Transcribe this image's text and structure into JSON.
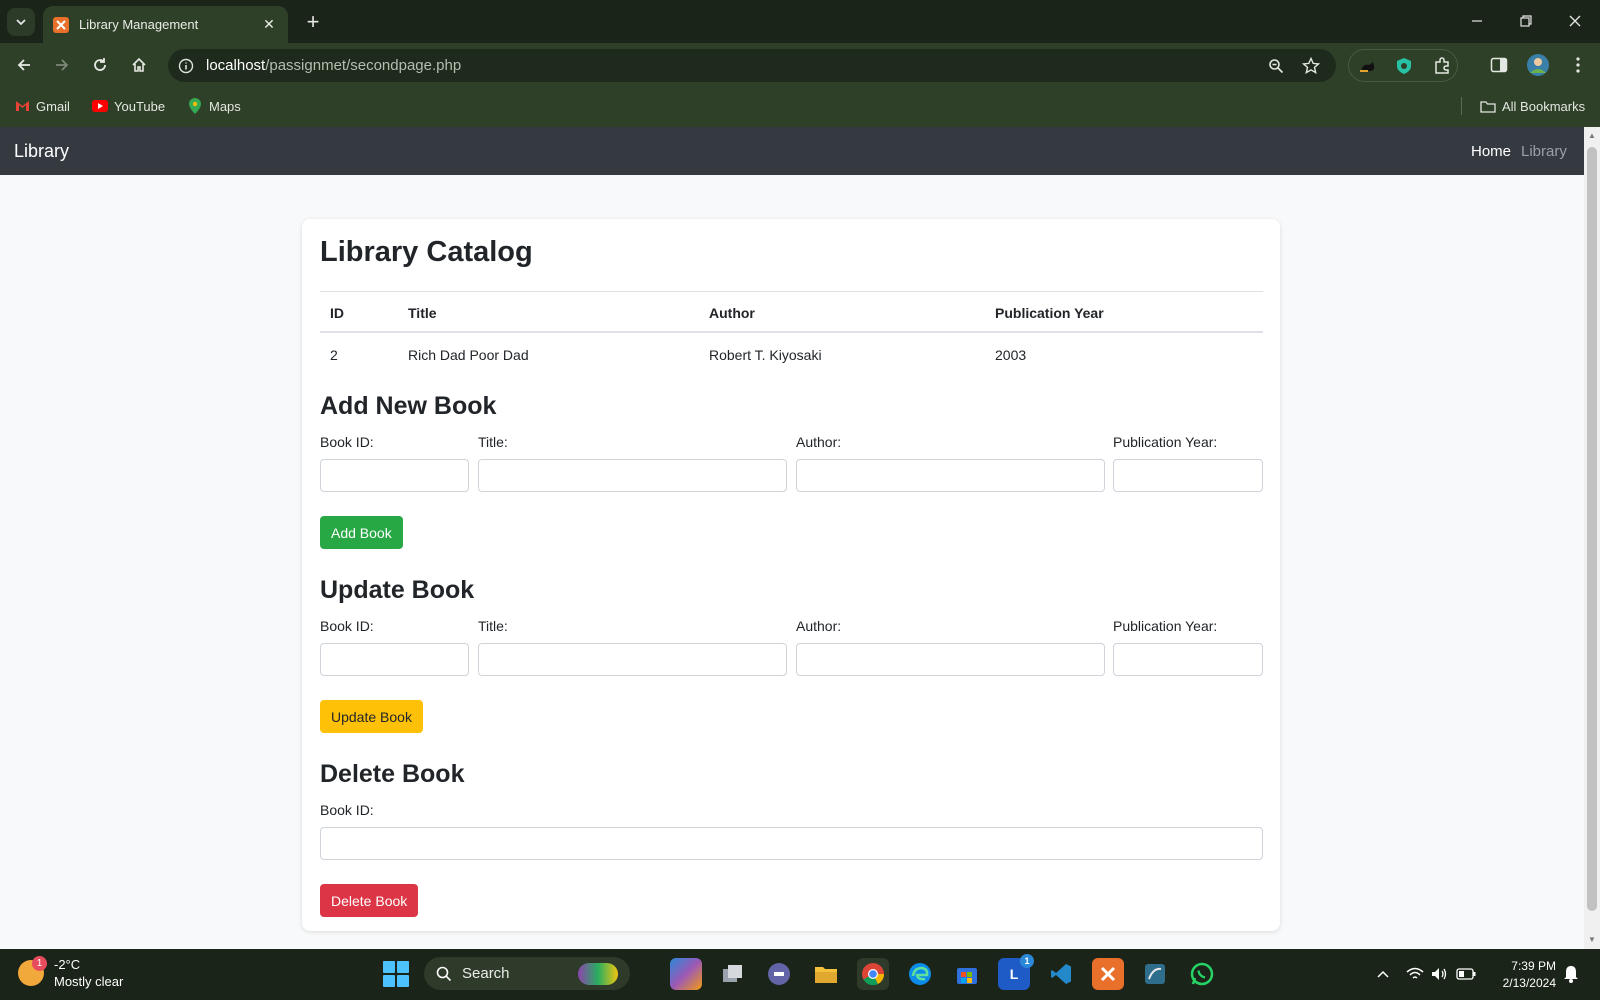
{
  "browser": {
    "tab_title": "Library Management",
    "tab_close": "✕",
    "new_tab": "+",
    "url_host": "localhost",
    "url_path": "/passignmet/secondpage.php",
    "bookmarks": [
      {
        "label": "Gmail",
        "icon": "gmail-icon",
        "color": "#ea4335"
      },
      {
        "label": "YouTube",
        "icon": "youtube-icon",
        "color": "#ff0000"
      },
      {
        "label": "Maps",
        "icon": "maps-icon",
        "color": "#34a853"
      }
    ],
    "all_bookmarks": "All Bookmarks"
  },
  "navbar": {
    "brand": "Library",
    "links": [
      {
        "label": "Home",
        "color": "#ffffff"
      },
      {
        "label": "Library",
        "color": "#9aa0a6"
      }
    ]
  },
  "catalog": {
    "title": "Library Catalog",
    "columns": [
      "ID",
      "Title",
      "Author",
      "Publication Year"
    ],
    "rows": [
      [
        "2",
        "Rich Dad Poor Dad",
        "Robert T. Kiyosaki",
        "2003"
      ]
    ]
  },
  "add_form": {
    "heading": "Add New Book",
    "labels": [
      "Book ID:",
      "Title:",
      "Author:",
      "Publication Year:"
    ],
    "button": "Add Book",
    "button_color": "#28a745"
  },
  "update_form": {
    "heading": "Update Book",
    "labels": [
      "Book ID:",
      "Title:",
      "Author:",
      "Publication Year:"
    ],
    "button": "Update Book",
    "button_color": "#ffc107"
  },
  "delete_form": {
    "heading": "Delete Book",
    "label": "Book ID:",
    "button": "Delete Book",
    "button_color": "#dc3545"
  },
  "taskbar": {
    "weather_badge": "1",
    "temperature": "-2°C",
    "condition": "Mostly clear",
    "search_label": "Search",
    "time": "7:39 PM",
    "date": "2/13/2024",
    "l_badge": "1"
  }
}
